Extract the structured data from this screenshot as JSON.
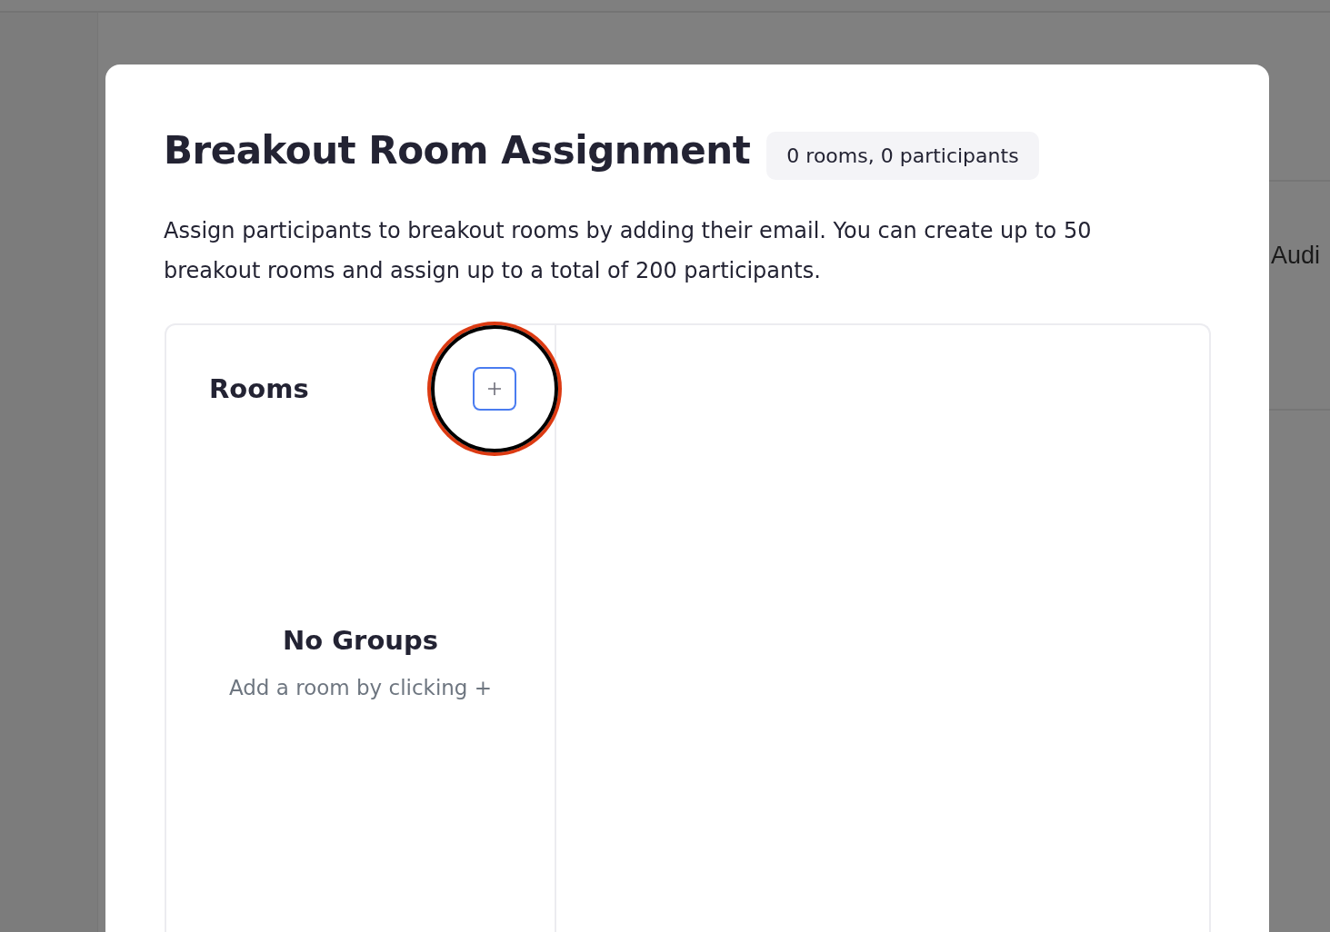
{
  "background": {
    "side_text": "Audi"
  },
  "dialog": {
    "title": "Breakout Room Assignment",
    "badge": "0 rooms, 0 participants",
    "description": "Assign participants to breakout rooms by adding their email. You can create up to 50 breakout rooms and assign up to a total of 200 participants.",
    "rooms_panel": {
      "title": "Rooms",
      "add_button": {
        "highlighted": true
      },
      "empty_title": "No Groups",
      "empty_hint": "Add a room by clicking +"
    }
  }
}
